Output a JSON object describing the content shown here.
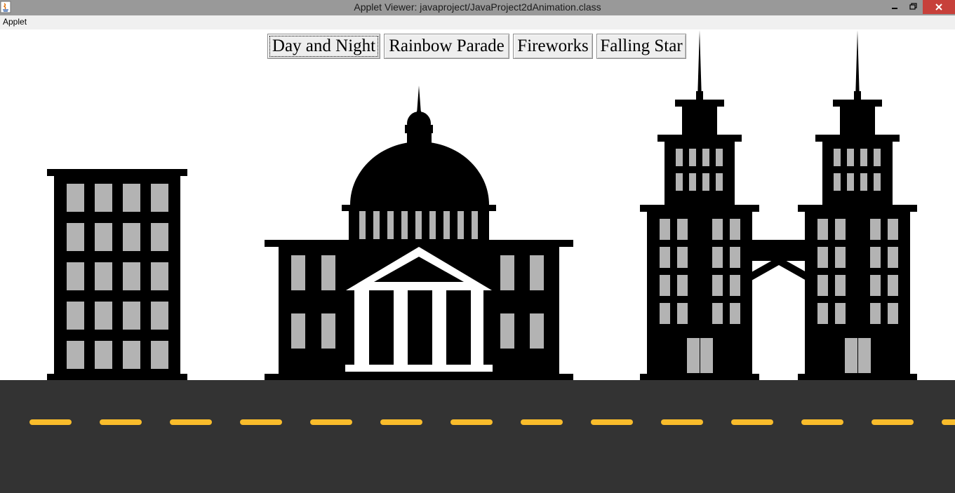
{
  "window": {
    "title": "Applet Viewer: javaproject/JavaProject2dAnimation.class",
    "close_color": "#c7403a"
  },
  "menu": {
    "applet_label": "Applet"
  },
  "buttons": {
    "day_and_night": "Day and Night",
    "rainbow_parade": "Rainbow Parade",
    "fireworks": "Fireworks",
    "falling_star": "Falling Star"
  },
  "colors": {
    "sky": "#ffffff",
    "building": "#000000",
    "window": "#b3b3b3",
    "road": "#333333",
    "lane_marking": "#f9bc2b"
  },
  "icons": [
    "java-icon",
    "minimize-icon",
    "maximize-icon",
    "close-icon"
  ]
}
